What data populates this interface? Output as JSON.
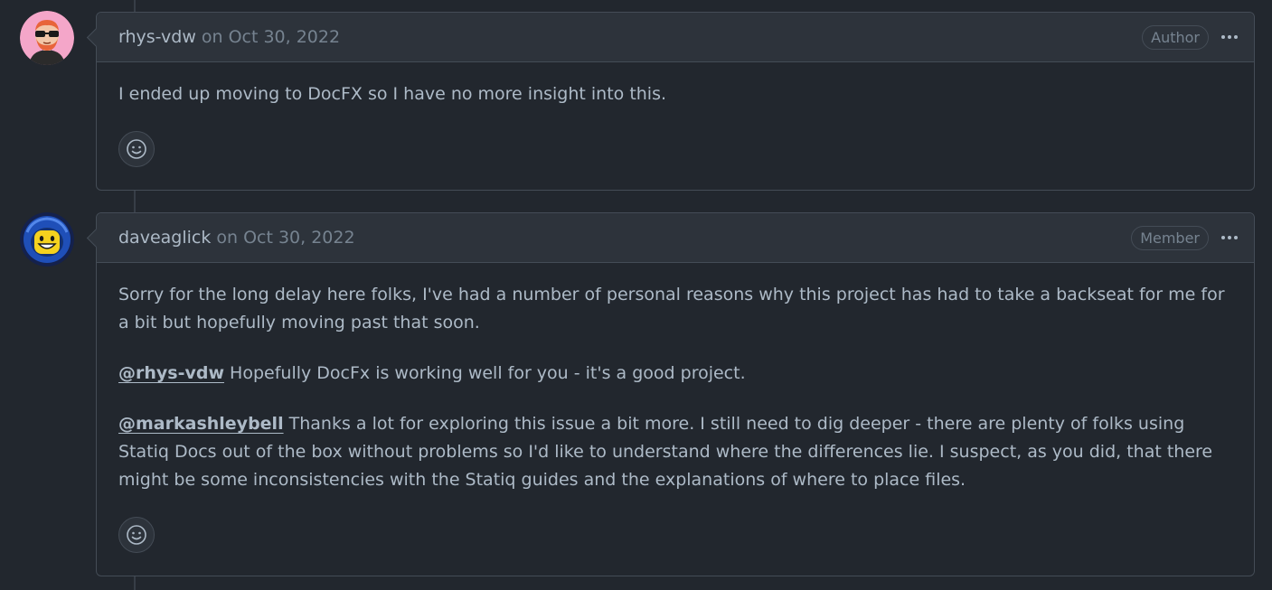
{
  "comments": [
    {
      "author": "rhys-vdw",
      "date": "on Oct 30, 2022",
      "role": "Author",
      "avatar": "cartoon-avatar-with-sunglasses",
      "paragraphs": [
        "I ended up moving to DocFX so I have no more insight into this."
      ]
    },
    {
      "author": "daveaglick",
      "date": "on Oct 30, 2022",
      "role": "Member",
      "avatar": "lego-spaceman-avatar",
      "p1": "Sorry for the long delay here folks, I've had a number of personal reasons why this project has had to take a backseat for me for a bit but hopefully moving past that soon.",
      "p2_mention": "@rhys-vdw",
      "p2_text": " Hopefully DocFx is working well for you - it's a good project.",
      "p3_mention": "@markashleybell",
      "p3_text": " Thanks a lot for exploring this issue a bit more. I still need to dig deeper - there are plenty of folks using Statiq Docs out of the box without problems so I'd like to understand where the differences lie. I suspect, as you did, that there might be some inconsistencies with the Statiq guides and the explanations of where to place files."
    }
  ],
  "icons": {
    "reaction": "smiley-icon",
    "menu": "kebab-horizontal-icon"
  },
  "colors": {
    "background": "#22272e",
    "header": "#2d333b",
    "border": "#444c56",
    "text": "#adbac7",
    "muted": "#768390"
  }
}
